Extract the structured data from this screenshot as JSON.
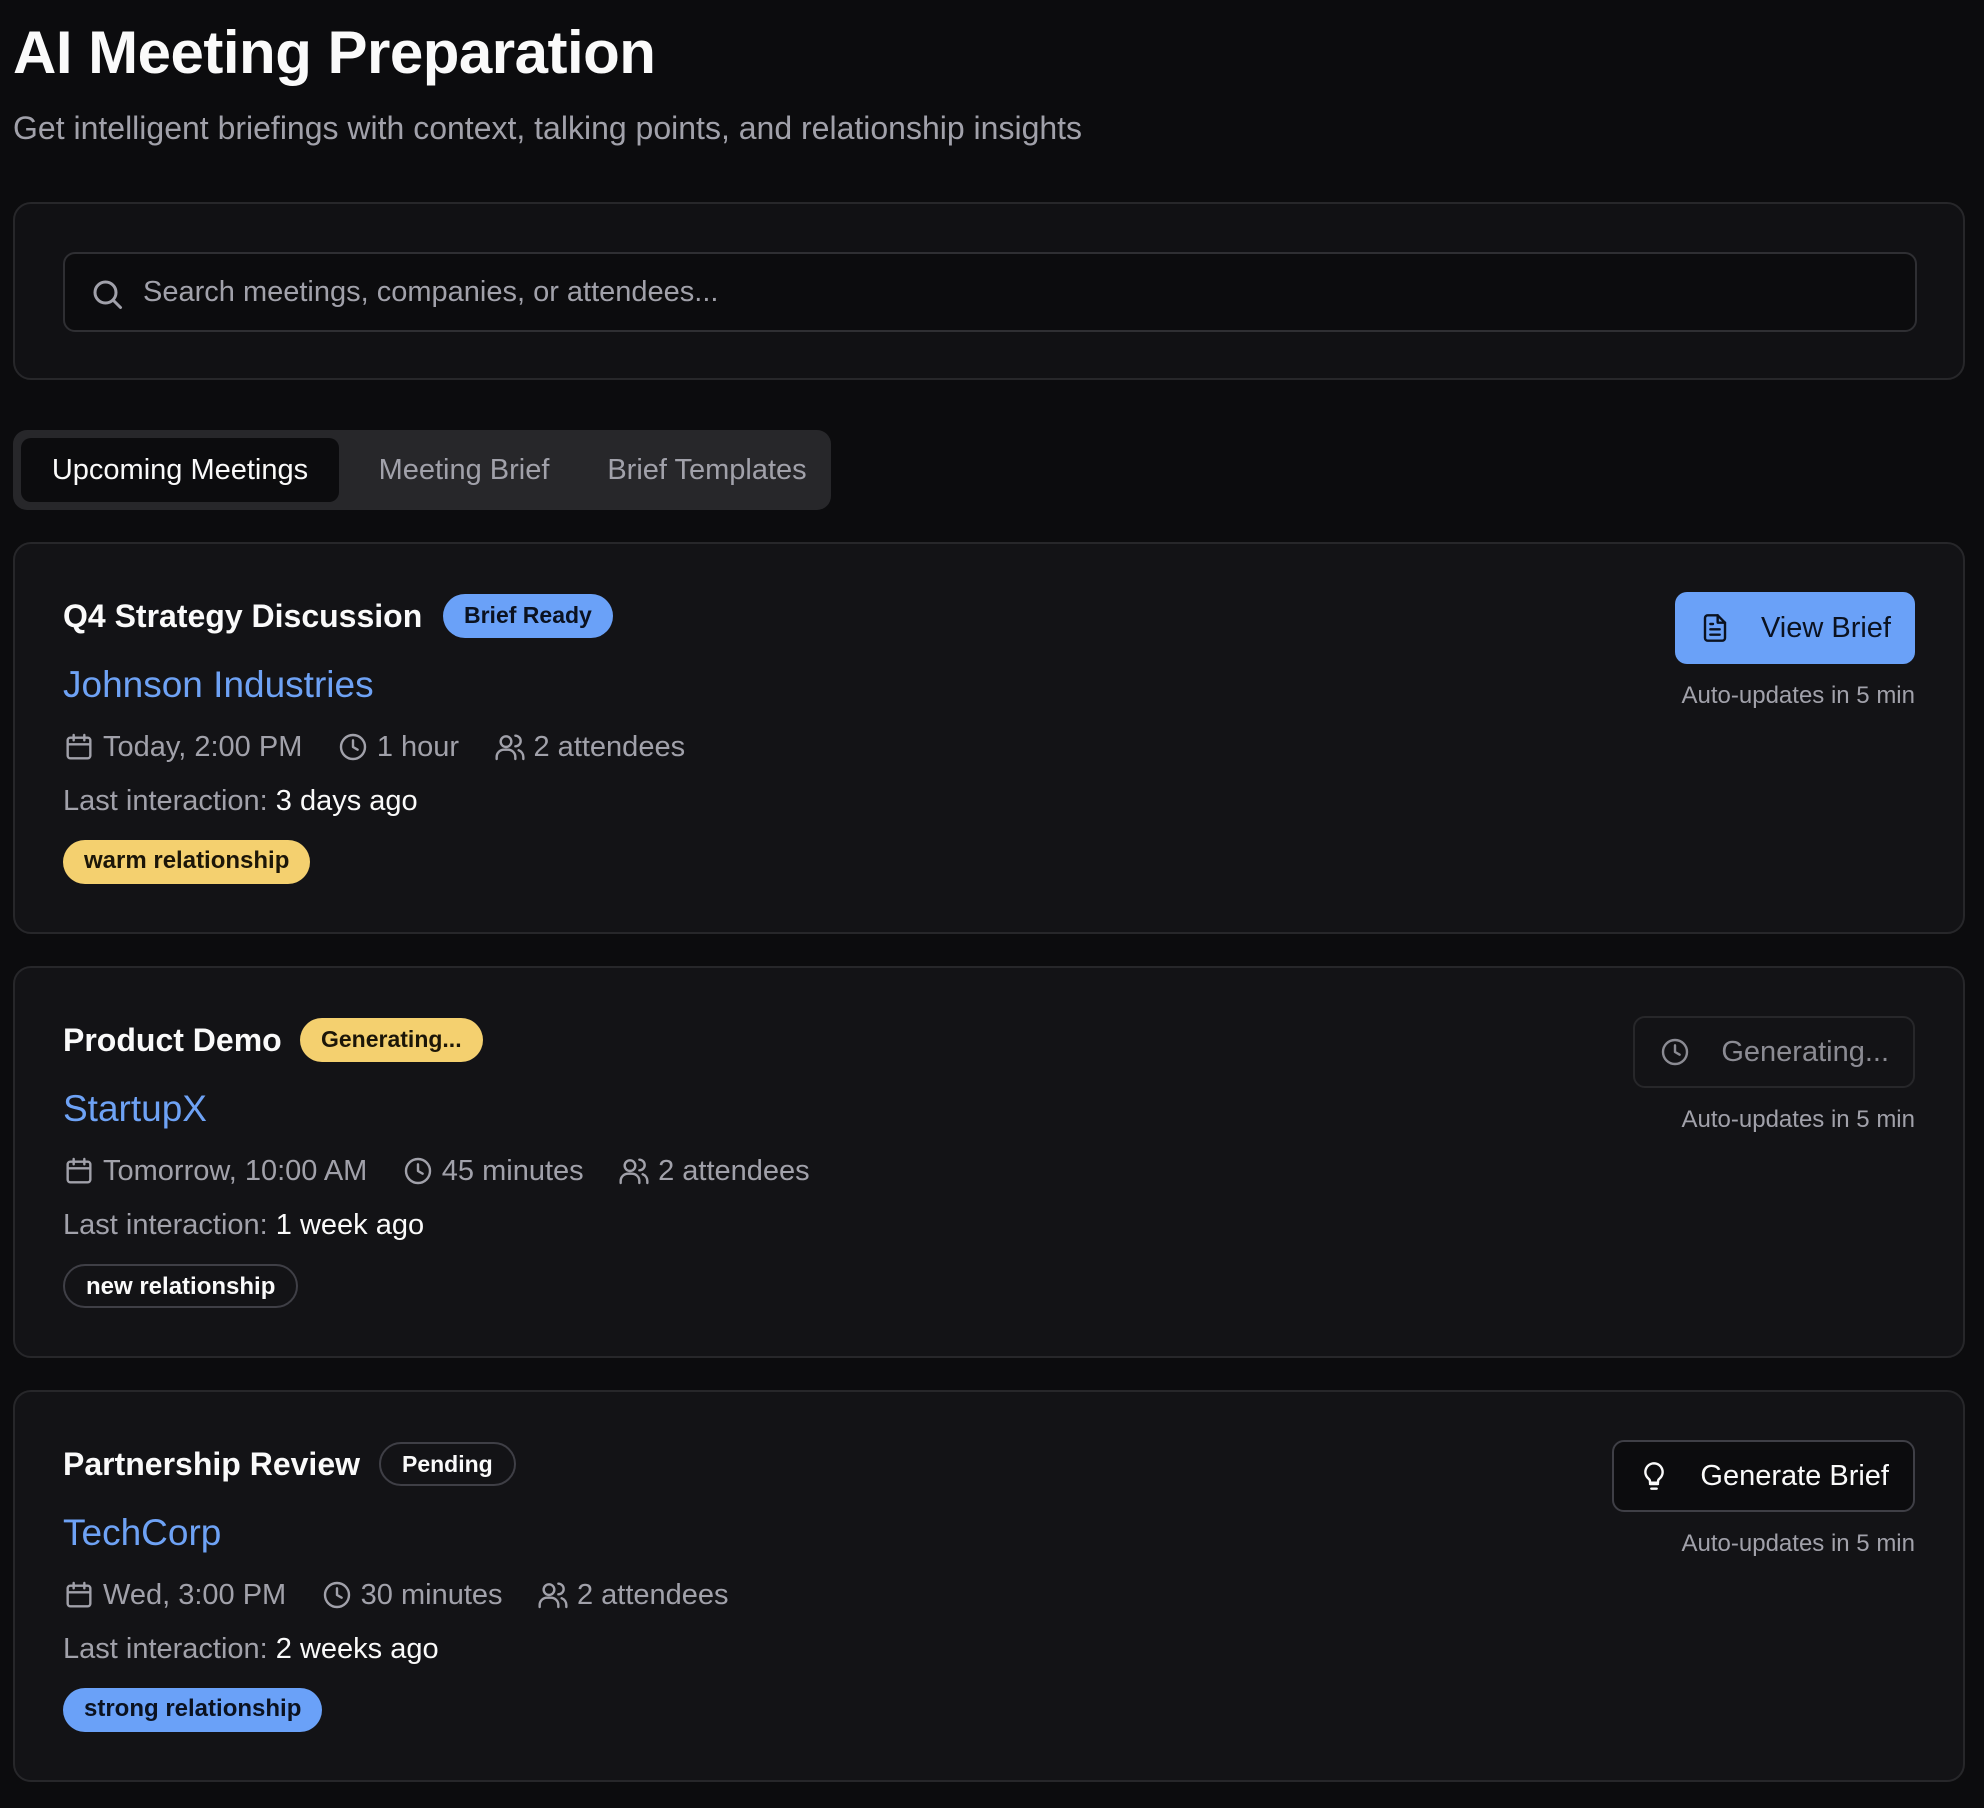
{
  "header": {
    "title": "AI Meeting Preparation",
    "subtitle": "Get intelligent briefings with context, talking points, and relationship insights"
  },
  "search": {
    "icon": "search-icon",
    "placeholder": "Search meetings, companies, or attendees...",
    "value": ""
  },
  "tabs": [
    {
      "label": "Upcoming Meetings",
      "active": true
    },
    {
      "label": "Meeting Brief",
      "active": false
    },
    {
      "label": "Brief Templates",
      "active": false
    }
  ],
  "meetings": [
    {
      "title": "Q4 Strategy Discussion",
      "status": "Brief Ready",
      "company": "Johnson Industries",
      "date": "Today, 2:00 PM",
      "duration": "1 hour",
      "attendees": "2 attendees",
      "last_interaction_label": "Last interaction:",
      "last_interaction": "3 days ago",
      "relationship": "warm relationship",
      "action": {
        "label": "View Brief",
        "icon": "file-text-icon"
      },
      "auto_update": "Auto-updates in 5 min"
    },
    {
      "title": "Product Demo",
      "status": "Generating...",
      "company": "StartupX",
      "date": "Tomorrow, 10:00 AM",
      "duration": "45 minutes",
      "attendees": "2 attendees",
      "last_interaction_label": "Last interaction:",
      "last_interaction": "1 week ago",
      "relationship": "new relationship",
      "action": {
        "label": "Generating...",
        "icon": "clock-icon"
      },
      "auto_update": "Auto-updates in 5 min"
    },
    {
      "title": "Partnership Review",
      "status": "Pending",
      "company": "TechCorp",
      "date": "Wed, 3:00 PM",
      "duration": "30 minutes",
      "attendees": "2 attendees",
      "last_interaction_label": "Last interaction:",
      "last_interaction": "2 weeks ago",
      "relationship": "strong relationship",
      "action": {
        "label": "Generate Brief",
        "icon": "lightbulb-icon"
      },
      "auto_update": "Auto-updates in 5 min"
    }
  ],
  "colors": {
    "background": "#0c0c0e",
    "card": "#131316",
    "accent_blue": "#6aa1f8",
    "accent_yellow": "#f4d06f",
    "muted_text": "#a1a1aa"
  }
}
